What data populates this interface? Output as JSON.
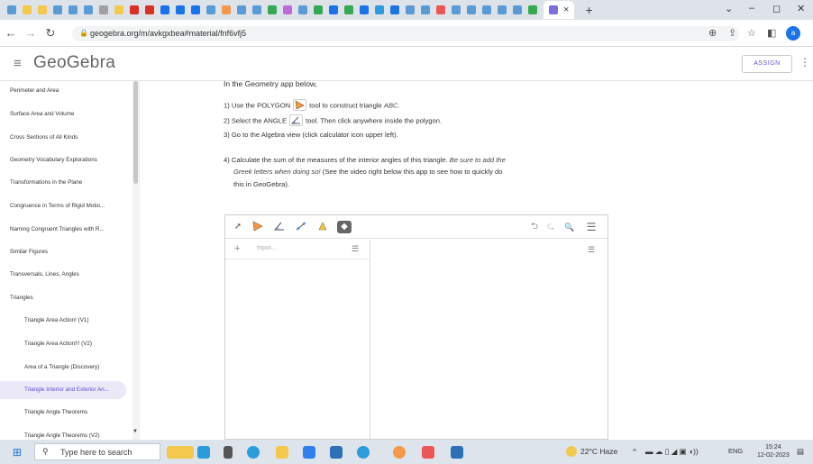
{
  "browser": {
    "active_tab_close": "×",
    "new_tab": "+",
    "window_controls": [
      "⌄",
      "–",
      "◻",
      "✕"
    ],
    "url": "geogebra.org/m/avkgxbea#material/fnf6vfj5"
  },
  "header": {
    "logo": "GeoGebra",
    "assign_label": "ASSIGN",
    "more": "⋮"
  },
  "sidebar": {
    "items": [
      {
        "label": "Perimeter and Area",
        "sub": false,
        "active": false
      },
      {
        "label": "Surface Area and Volume",
        "sub": false,
        "active": false
      },
      {
        "label": "Cross Sections of All Kinds",
        "sub": false,
        "active": false
      },
      {
        "label": "Geometry Vocabulary Explorations",
        "sub": false,
        "active": false
      },
      {
        "label": "Transformations in the Plane",
        "sub": false,
        "active": false
      },
      {
        "label": "Congruence in Terms of Rigid Motio...",
        "sub": false,
        "active": false
      },
      {
        "label": "Naming Congruent Triangles with R...",
        "sub": false,
        "active": false
      },
      {
        "label": "Similar Figures",
        "sub": false,
        "active": false
      },
      {
        "label": "Transversals, Lines, Angles",
        "sub": false,
        "active": false
      },
      {
        "label": "Triangles",
        "sub": false,
        "active": false
      },
      {
        "label": "Triangle Area Action! (V1)",
        "sub": true,
        "active": false
      },
      {
        "label": "Triangle Area Action!!! (V2)",
        "sub": true,
        "active": false
      },
      {
        "label": "Area of a Triangle (Discovery)",
        "sub": true,
        "active": false
      },
      {
        "label": "Triangle Interior and Exterior An...",
        "sub": true,
        "active": true
      },
      {
        "label": "Triangle Angle Theorems",
        "sub": true,
        "active": false
      },
      {
        "label": "Triangle Angle Theorems (V2)",
        "sub": true,
        "active": false
      }
    ]
  },
  "instructions": {
    "intro": "In the Geometry app below,",
    "step1_a": "1) Use the POLYGON",
    "step1_b": "tool to construct triangle",
    "step1_c": "ABC.",
    "step2_a": "2) Select the ANGLE",
    "step2_b": "tool.  Then click anywhere inside the polygon.",
    "step3": "3) Go to the Algebra view (click calculator icon upper left).",
    "step4_line1_a": "4) Calculate the sum of the measures of the interior angles of this triangle.",
    "step4_line1_b": "Be sure to add the",
    "step4_line2_a": "Greek letters when doing so!",
    "step4_line2_b": "(See the video right below this app to see how to quickly do",
    "step4_line3": "this in GeoGebra)."
  },
  "applet": {
    "input_placeholder": "Input...",
    "plus": "+",
    "undo": "⮌",
    "redo": "⮎",
    "search": "🔍",
    "menu": "☰"
  },
  "taskbar": {
    "search_placeholder": "Type here to search",
    "weather": "22°C  Haze",
    "language": "ENG",
    "time": "15:24",
    "date": "12-02-2023"
  },
  "colors": {
    "accent": "#6557d2",
    "active_item_bg": "#ebe8f7"
  }
}
